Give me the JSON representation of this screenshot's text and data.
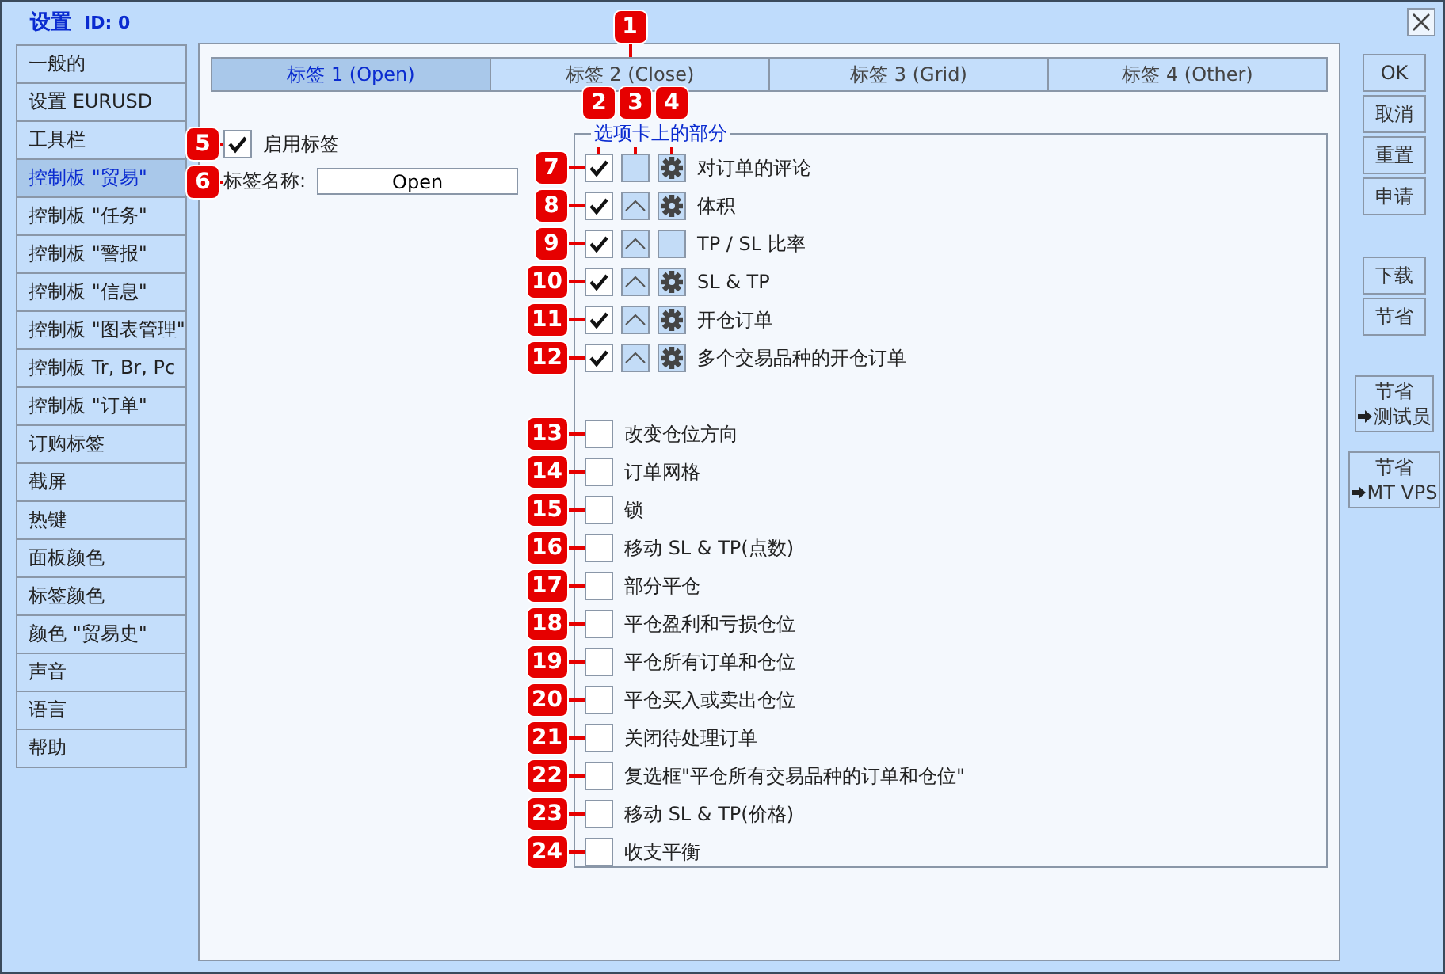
{
  "window": {
    "title": "设置",
    "id": "ID: 0"
  },
  "sidebar": {
    "items": [
      {
        "label": "一般的",
        "selected": false
      },
      {
        "label": "设置 EURUSD",
        "selected": false
      },
      {
        "label": "工具栏",
        "selected": false
      },
      {
        "label": "控制板 \"贸易\"",
        "selected": true
      },
      {
        "label": "控制板 \"任务\"",
        "selected": false
      },
      {
        "label": "控制板 \"警报\"",
        "selected": false
      },
      {
        "label": "控制板 \"信息\"",
        "selected": false
      },
      {
        "label": "控制板 \"图表管理\"",
        "selected": false
      },
      {
        "label": "控制板 Tr, Br, Pc",
        "selected": false
      },
      {
        "label": "控制板 \"订单\"",
        "selected": false
      },
      {
        "label": "订购标签",
        "selected": false
      },
      {
        "label": "截屏",
        "selected": false
      },
      {
        "label": "热键",
        "selected": false
      },
      {
        "label": "面板颜色",
        "selected": false
      },
      {
        "label": "标签颜色",
        "selected": false
      },
      {
        "label": "颜色 \"贸易史\"",
        "selected": false
      },
      {
        "label": "声音",
        "selected": false
      },
      {
        "label": "语言",
        "selected": false
      },
      {
        "label": "帮助",
        "selected": false
      }
    ]
  },
  "tabs": {
    "callout": "1",
    "items": [
      {
        "label": "标签 1 (Open)",
        "selected": true
      },
      {
        "label": "标签 2 (Close)",
        "selected": false
      },
      {
        "label": "标签 3 (Grid)",
        "selected": false
      },
      {
        "label": "标签 4 (Other)",
        "selected": false
      }
    ]
  },
  "enable_tab": {
    "label": "启用标签",
    "checked": true,
    "callout": "5"
  },
  "tab_name": {
    "label": "标签名称:",
    "value": "Open",
    "callout": "6"
  },
  "sections_group": {
    "title": "选项卡上的部分",
    "column_callouts": [
      "2",
      "3",
      "4"
    ],
    "sections": [
      [
        {
          "kind": "full",
          "callout": "7",
          "checked": true,
          "up_arrow": false,
          "gear": true,
          "label": "对订单的评论"
        },
        {
          "kind": "full",
          "callout": "8",
          "checked": true,
          "up_arrow": true,
          "gear": true,
          "label": "体积"
        },
        {
          "kind": "full",
          "callout": "9",
          "checked": true,
          "up_arrow": true,
          "gear": false,
          "label": "TP / SL 比率"
        },
        {
          "kind": "full",
          "callout": "10",
          "checked": true,
          "up_arrow": true,
          "gear": true,
          "label": "SL & TP"
        },
        {
          "kind": "full",
          "callout": "11",
          "checked": true,
          "up_arrow": true,
          "gear": true,
          "label": "开仓订单"
        },
        {
          "kind": "full",
          "callout": "12",
          "checked": true,
          "up_arrow": true,
          "gear": true,
          "label": "多个交易品种的开仓订单"
        }
      ],
      [
        {
          "kind": "plain",
          "callout": "13",
          "checked": false,
          "label": "改变仓位方向"
        },
        {
          "kind": "plain",
          "callout": "14",
          "checked": false,
          "label": "订单网格"
        },
        {
          "kind": "plain",
          "callout": "15",
          "checked": false,
          "label": "锁"
        },
        {
          "kind": "plain",
          "callout": "16",
          "checked": false,
          "label": "移动 SL & TP(点数)"
        },
        {
          "kind": "plain",
          "callout": "17",
          "checked": false,
          "label": "部分平仓"
        },
        {
          "kind": "plain",
          "callout": "18",
          "checked": false,
          "label": "平仓盈利和亏损仓位"
        },
        {
          "kind": "plain",
          "callout": "19",
          "checked": false,
          "label": "平仓所有订单和仓位"
        },
        {
          "kind": "plain",
          "callout": "20",
          "checked": false,
          "label": "平仓买入或卖出仓位"
        },
        {
          "kind": "plain",
          "callout": "21",
          "checked": false,
          "label": "关闭待处理订单"
        },
        {
          "kind": "plain",
          "callout": "22",
          "checked": false,
          "label": "复选框\"平仓所有交易品种的订单和仓位\""
        },
        {
          "kind": "plain",
          "callout": "23",
          "checked": false,
          "label": "移动 SL & TP(价格)"
        },
        {
          "kind": "plain",
          "callout": "24",
          "checked": false,
          "label": "收支平衡"
        }
      ]
    ]
  },
  "buttons": [
    [
      {
        "lines": [
          "OK"
        ],
        "arrow": false
      },
      {
        "lines": [
          "取消"
        ],
        "arrow": false
      },
      {
        "lines": [
          "重置"
        ],
        "arrow": false
      },
      {
        "lines": [
          "申请"
        ],
        "arrow": false
      }
    ],
    [
      {
        "lines": [
          "下载"
        ],
        "arrow": false
      },
      {
        "lines": [
          "节省"
        ],
        "arrow": false
      }
    ],
    [
      {
        "lines": [
          "节省",
          "测试员"
        ],
        "arrow": true
      },
      {
        "lines": [
          "节省",
          "MT VPS"
        ],
        "arrow": true
      }
    ]
  ]
}
